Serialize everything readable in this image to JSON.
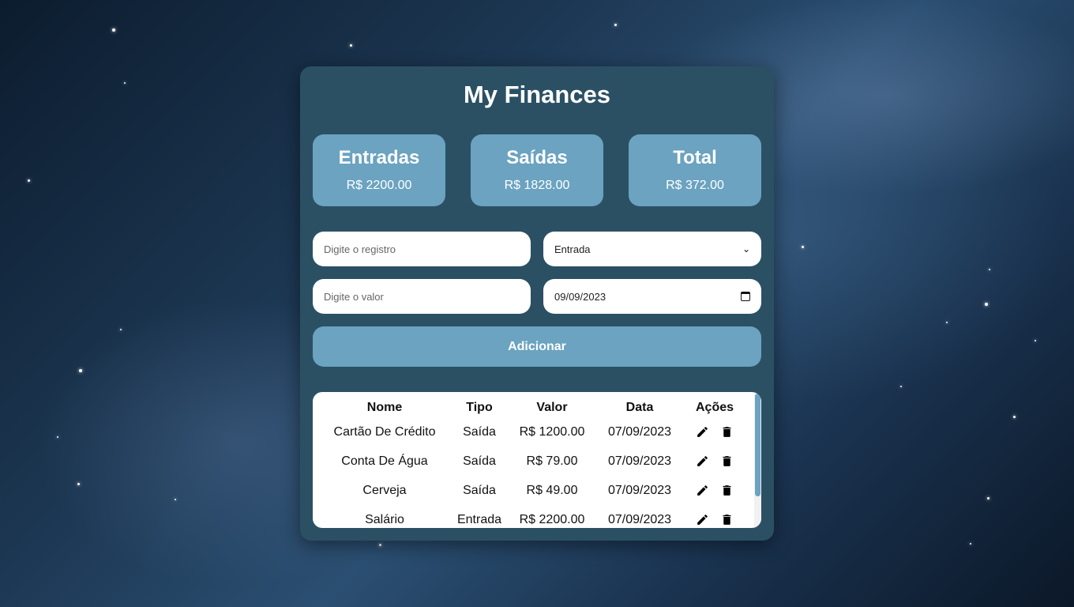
{
  "app": {
    "title": "My Finances"
  },
  "summary": [
    {
      "label": "Entradas",
      "value": "R$ 2200.00"
    },
    {
      "label": "Saídas",
      "value": "R$ 1828.00"
    },
    {
      "label": "Total",
      "value": "R$ 372.00"
    }
  ],
  "form": {
    "registro_placeholder": "Digite o registro",
    "valor_placeholder": "Digite o valor",
    "tipo_selected": "Entrada",
    "date_value": "09/09/2023",
    "add_label": "Adicionar"
  },
  "table": {
    "headers": [
      "Nome",
      "Tipo",
      "Valor",
      "Data",
      "Ações"
    ],
    "rows": [
      {
        "nome": "Cartão De Crédito",
        "tipo": "Saída",
        "valor": "R$ 1200.00",
        "data": "07/09/2023"
      },
      {
        "nome": "Conta De Água",
        "tipo": "Saída",
        "valor": "R$ 79.00",
        "data": "07/09/2023"
      },
      {
        "nome": "Cerveja",
        "tipo": "Saída",
        "valor": "R$ 49.00",
        "data": "07/09/2023"
      },
      {
        "nome": "Salário",
        "tipo": "Entrada",
        "valor": "R$ 2200.00",
        "data": "07/09/2023"
      }
    ]
  },
  "icons": {
    "edit": "pencil-icon",
    "delete": "trash-icon",
    "date": "calendar-icon",
    "select": "chevron-down-icon"
  },
  "colors": {
    "card": "#2b5064",
    "accent": "#6ba3c0"
  }
}
